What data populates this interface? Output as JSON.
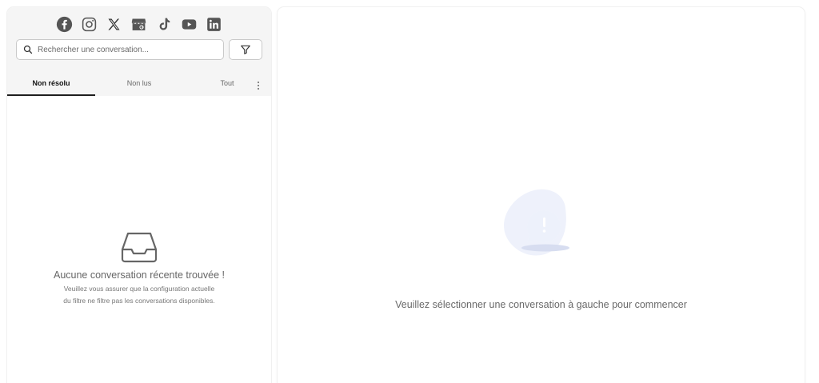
{
  "social": [
    {
      "name": "facebook-icon"
    },
    {
      "name": "instagram-icon"
    },
    {
      "name": "x-twitter-icon"
    },
    {
      "name": "google-business-icon"
    },
    {
      "name": "tiktok-icon"
    },
    {
      "name": "youtube-icon"
    },
    {
      "name": "linkedin-icon"
    }
  ],
  "search": {
    "placeholder": "Rechercher une conversation..."
  },
  "tabs": [
    {
      "label": "Non résolu",
      "active": true
    },
    {
      "label": "Non lus",
      "active": false
    },
    {
      "label": "Tout",
      "active": false
    }
  ],
  "empty_state": {
    "title": "Aucune conversation récente trouvée !",
    "desc_line1": "Veuillez vous assurer que la configuration actuelle",
    "desc_line2": "du filtre ne filtre pas les conversations disponibles."
  },
  "main": {
    "message": "Veuillez sélectionner une conversation à gauche pour commencer"
  },
  "colors": {
    "icon": "#555555",
    "accent_tab": "#1f1f1f",
    "illustration_bg": "#eef1fb",
    "illustration_bubble": "#d9e0f6"
  }
}
